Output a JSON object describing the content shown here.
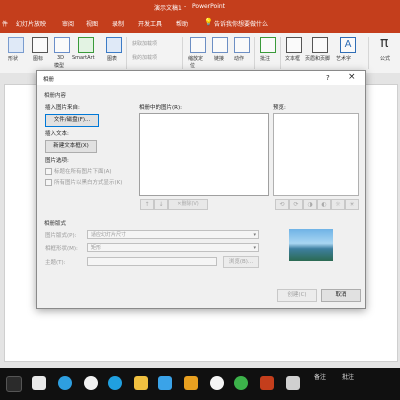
{
  "window": {
    "doc_title": "演示文稿1",
    "separator": " - ",
    "app_name": "PowerPoint",
    "search_hint": "告诉我你想要做什么"
  },
  "ribbon_tabs": [
    "件",
    "幻灯片放映",
    "审阅",
    "视图",
    "录制",
    "开发工具",
    "帮助"
  ],
  "ribbon": {
    "new_album": "新建相册",
    "album_sub": "相册",
    "shapes": "形状",
    "icons": "图标",
    "model_3d_line1": "3D",
    "model_3d_line2": "模型",
    "smartart": "SmartArt",
    "chart": "图表",
    "get_addins": "获取加载项",
    "my_addins": "我的加载项",
    "zoom_label": "缩放定",
    "zoom_sub": "位",
    "link": "链接",
    "action": "动作",
    "comment": "批注",
    "textbox": "文本框",
    "header_footer": "页眉和页脚",
    "wordart": "艺术字",
    "equation": "公式"
  },
  "dialog": {
    "title": "相册",
    "help": "?",
    "close": "×",
    "section_album_content": "相册内容",
    "insert_picture_from": "插入图片来自:",
    "file_disk_button": "文件/磁盘(F)...",
    "insert_text": "插入文本:",
    "new_textbox_button": "新建文本框(X)",
    "picture_options": "图片选项:",
    "caption_below_all": "标题在所有图片下面(A)",
    "all_pictures_bw": "所有图片以黑白方式显示(K)",
    "pictures_in_album": "相册中的图片(R):",
    "preview": "预览:",
    "move_up": "↑",
    "move_down": "↓",
    "remove_button": "删除(V)",
    "section_album_layout": "相册版式",
    "picture_layout_label": "图片版式(P):",
    "picture_layout_value": "适应幻灯片尺寸",
    "frame_shape_label": "相框形状(M):",
    "frame_shape_value": "矩形",
    "theme_label": "主题(T):",
    "theme_value": "",
    "browse_button": "浏览(B)...",
    "create_button": "创建(C)",
    "cancel_button": "取消"
  },
  "taskbar": {
    "notes": "备注",
    "comments": "批注"
  }
}
